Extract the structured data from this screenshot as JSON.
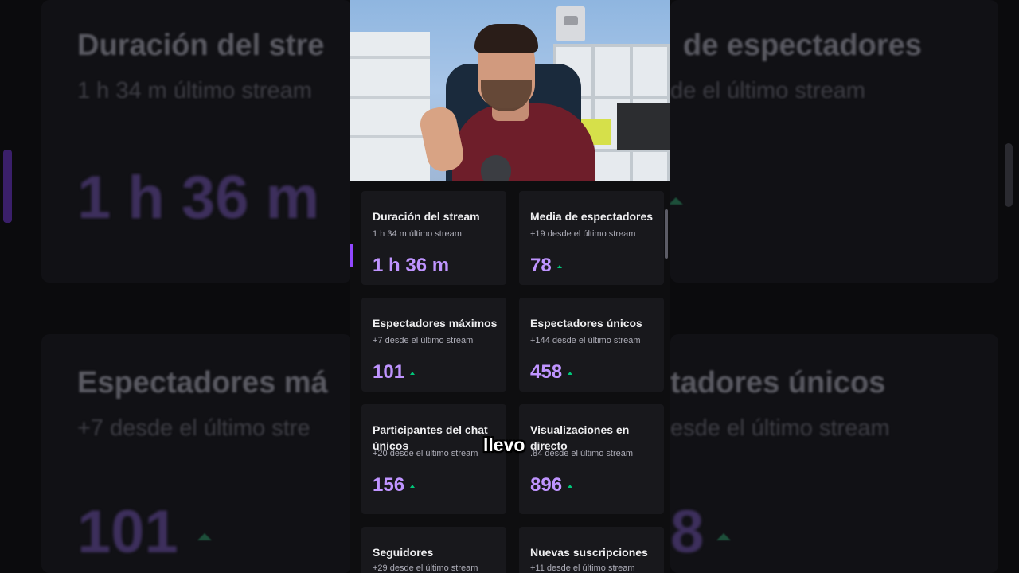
{
  "background": {
    "cards": [
      {
        "title": "Duración del stre",
        "sub": "1 h 34 m último stream",
        "value": "1 h 36 m"
      },
      {
        "title": "de espectadores",
        "sub": "de el último stream"
      },
      {
        "title": "Espectadores má",
        "sub": "+7 desde el último stre",
        "value": "101"
      },
      {
        "title": "tadores únicos",
        "sub": "esde el último stream",
        "value": "8"
      }
    ]
  },
  "cards": [
    {
      "title": "Duración del stream",
      "sub": "1 h 34 m último stream",
      "value": "1 h 36 m",
      "up": false
    },
    {
      "title": "Media de espectadores",
      "sub": "+19 desde el último stream",
      "value": "78",
      "up": true
    },
    {
      "title": "Espectadores máximos",
      "sub": "+7 desde el último stream",
      "value": "101",
      "up": true
    },
    {
      "title": "Espectadores únicos",
      "sub": "+144 desde el último stream",
      "value": "458",
      "up": true
    },
    {
      "title": "Participantes del chat únicos",
      "sub": "+20 desde el último stream",
      "value": "156",
      "up": true
    },
    {
      "title": "Visualizaciones en directo",
      "sub": ".84 desde el último stream",
      "value": "896",
      "up": true
    },
    {
      "title": "Seguidores",
      "sub": "+29 desde el último stream",
      "value": "",
      "up": false
    },
    {
      "title": "Nuevas suscripciones",
      "sub": "+11 desde el último stream",
      "value": "",
      "up": false
    }
  ],
  "caption": "llevo",
  "colors": {
    "accent": "#bf94ff",
    "up_arrow": "#00c67a",
    "card_bg": "#18181c"
  }
}
